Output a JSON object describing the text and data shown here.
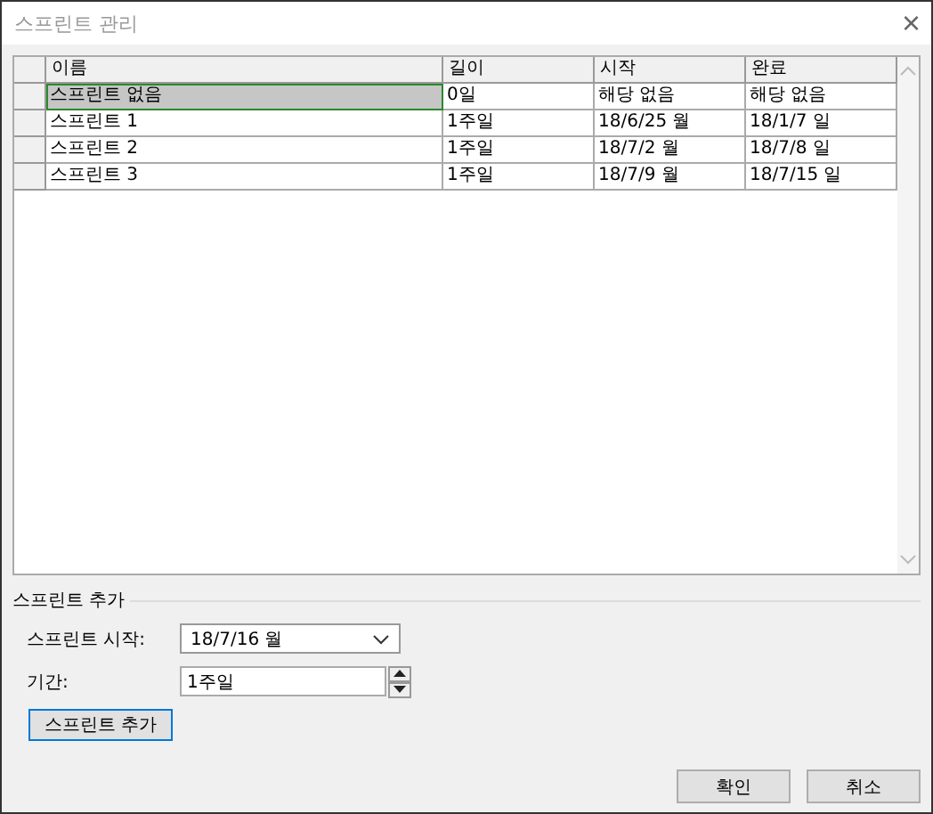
{
  "window": {
    "title": "스프린트 관리",
    "close": "×"
  },
  "table": {
    "columns": [
      "이름",
      "길이",
      "시작",
      "완료"
    ],
    "rows": [
      {
        "cells": [
          "스프린트 없음",
          "0일",
          "해당 없음",
          "해당 없음"
        ],
        "selected": true
      },
      {
        "cells": [
          "스프린트 1",
          "1주일",
          "18/6/25 월",
          "18/1/7 일"
        ],
        "selected": false
      },
      {
        "cells": [
          "스프린트 2",
          "1주일",
          "18/7/2 월",
          "18/7/8 일"
        ],
        "selected": false
      },
      {
        "cells": [
          "스프린트 3",
          "1주일",
          "18/7/9 월",
          "18/7/15 일"
        ],
        "selected": false
      }
    ]
  },
  "add_sprint": {
    "title": "스프린트 추가",
    "start": {
      "label": "스프린트 시작:",
      "value": "18/7/16 월"
    },
    "duration": {
      "label": "기간:",
      "value": "1주일"
    },
    "button": "스프린트 추가"
  },
  "buttons": [
    "확인",
    "취소"
  ]
}
